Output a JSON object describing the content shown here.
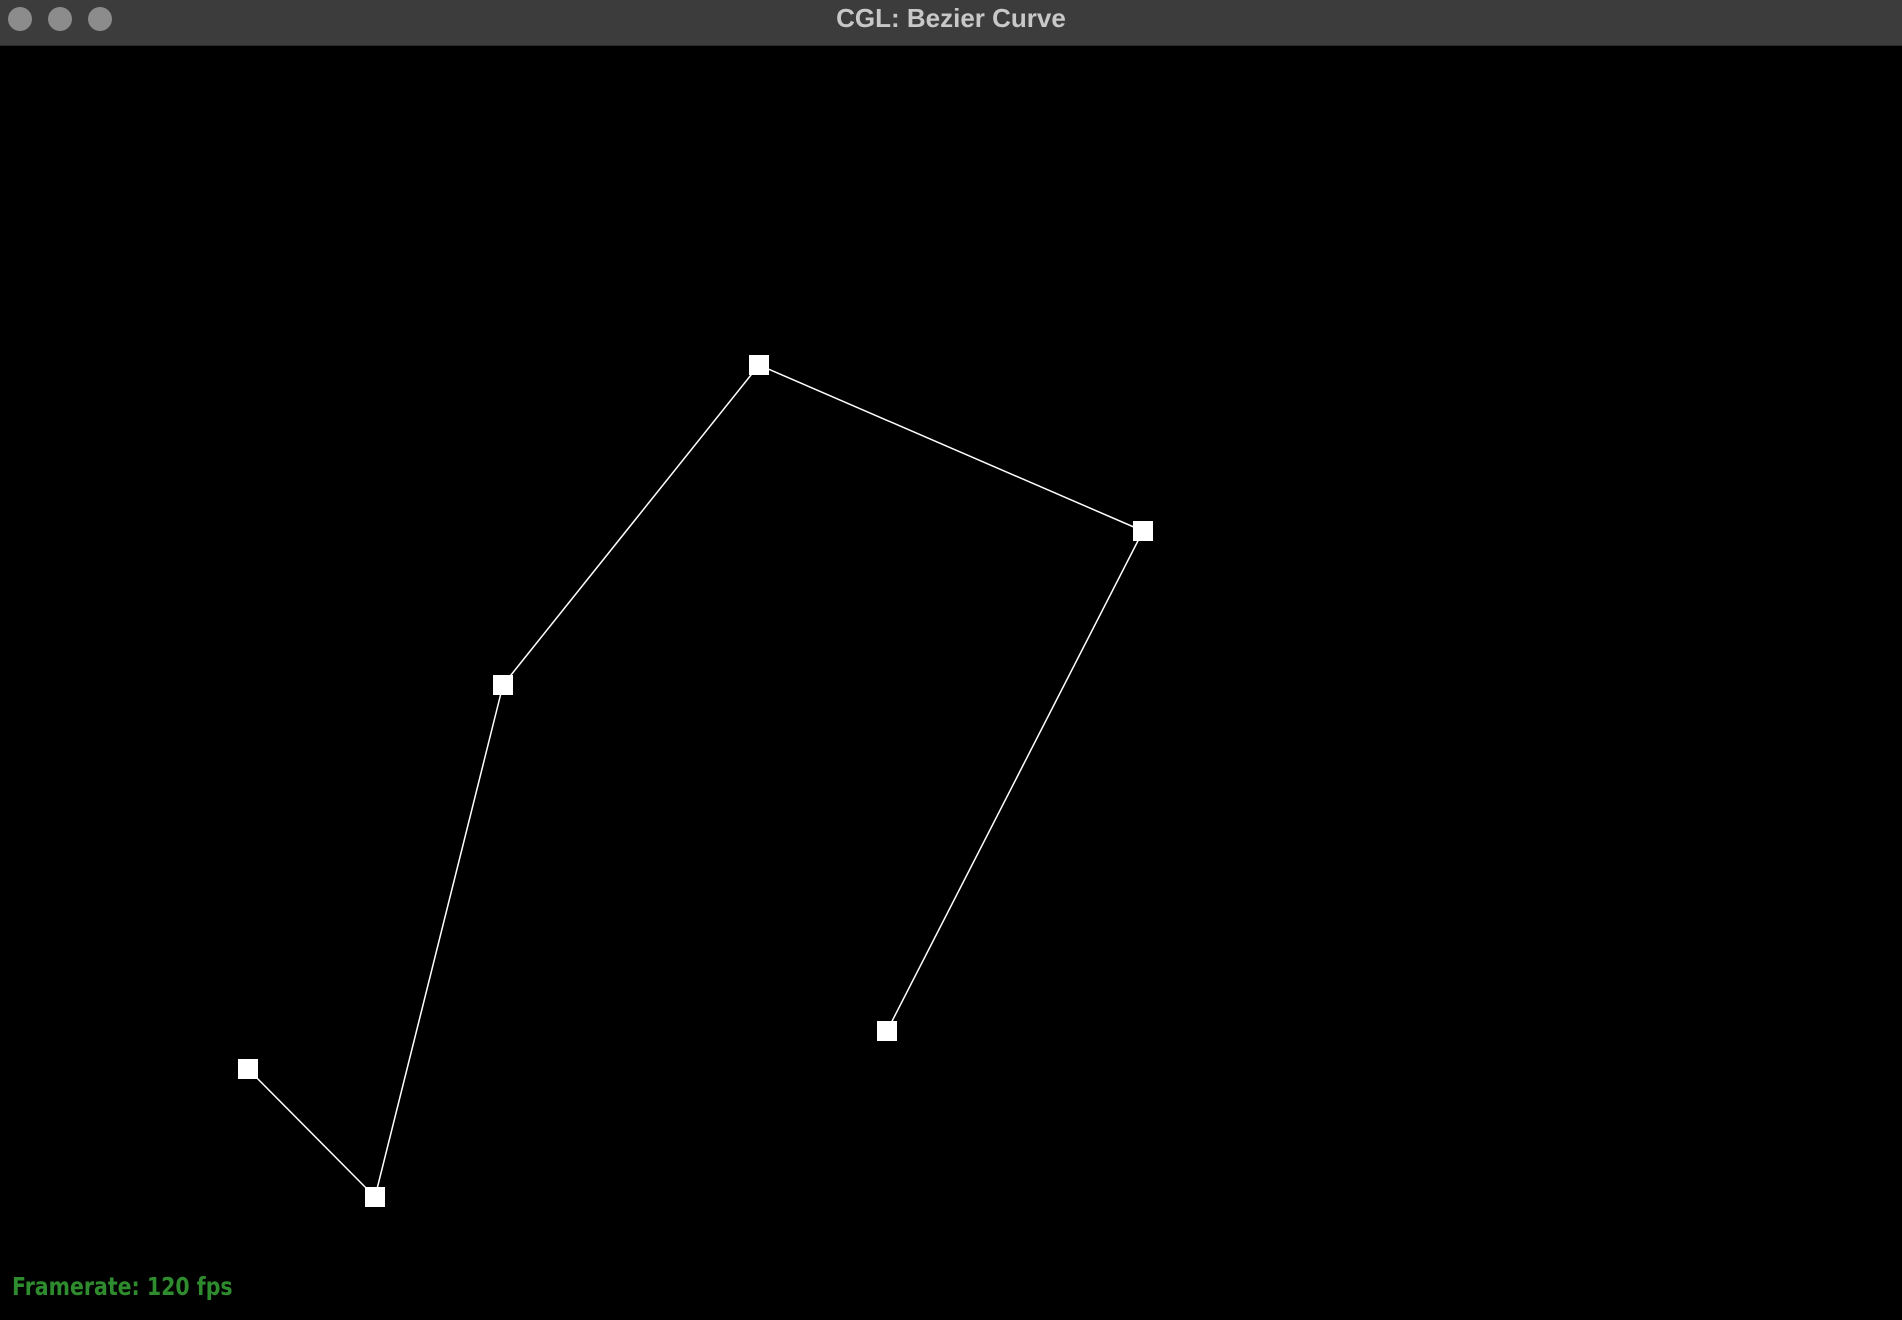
{
  "window": {
    "title": "CGL: Bezier Curve"
  },
  "overlay": {
    "framerate_text": "Framerate: 120 fps"
  },
  "colors": {
    "background": "#000000",
    "titlebar": "#3c3c3c",
    "title_text": "#c8c8c8",
    "control_point": "#ffffff",
    "polygon_line": "#ffffff",
    "framerate_text": "#2e8b2e"
  },
  "icons": {
    "close": "traffic-light-circle",
    "minimize": "traffic-light-circle",
    "zoom": "traffic-light-circle"
  }
}
